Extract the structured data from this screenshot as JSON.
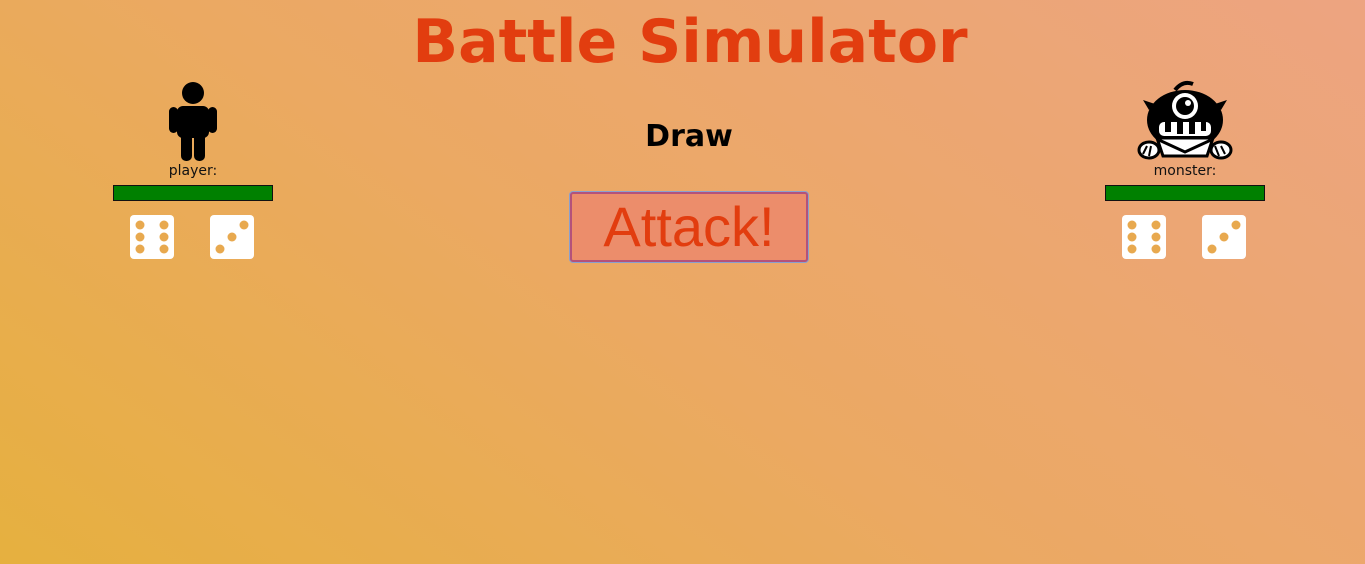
{
  "title": "Battle Simulator",
  "status_text": "Draw",
  "attack_label": "Attack!",
  "colors": {
    "title": "#e23d0f",
    "health_bar": "#008000",
    "attack_bg": "#ec8d6b"
  },
  "player": {
    "label": "player:",
    "icon": "person-icon",
    "health_fraction": 1.0,
    "dice": [
      6,
      3
    ]
  },
  "monster": {
    "label": "monster:",
    "icon": "monster-icon",
    "health_fraction": 1.0,
    "dice": [
      6,
      3
    ]
  }
}
